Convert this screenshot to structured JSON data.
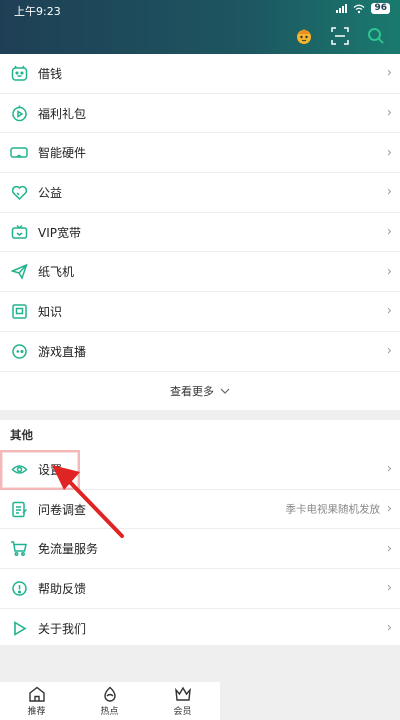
{
  "status_bar": {
    "time": "上午9:23",
    "battery": "96"
  },
  "colors": {
    "accent": "#21b38e",
    "header_start": "#1f3f55",
    "header_end": "#1a7a6f"
  },
  "menu_items": [
    {
      "label": "借钱",
      "icon": "piggy-icon"
    },
    {
      "label": "福利礼包",
      "icon": "play-circle-icon"
    },
    {
      "label": "智能硬件",
      "icon": "vr-glasses-icon"
    },
    {
      "label": "公益",
      "icon": "heart-icon"
    },
    {
      "label": "VIP宽带",
      "icon": "tv-icon"
    },
    {
      "label": "纸飞机",
      "icon": "paper-plane-icon"
    },
    {
      "label": "知识",
      "icon": "book-icon"
    },
    {
      "label": "游戏直播",
      "icon": "gamepad-icon"
    }
  ],
  "see_more": "查看更多",
  "other_section": {
    "title": "其他",
    "items": [
      {
        "label": "设置",
        "icon": "eye-settings-icon",
        "extra": ""
      },
      {
        "label": "问卷调查",
        "icon": "survey-icon",
        "extra": "季卡电视果随机发放"
      },
      {
        "label": "免流量服务",
        "icon": "cart-icon",
        "extra": ""
      },
      {
        "label": "帮助反馈",
        "icon": "help-icon",
        "extra": ""
      },
      {
        "label": "关于我们",
        "icon": "play-icon",
        "extra": ""
      }
    ]
  },
  "tabbar": {
    "items": [
      {
        "label": "推荐",
        "icon": "home-icon"
      },
      {
        "label": "热点",
        "icon": "hot-icon"
      },
      {
        "label": "会员",
        "icon": "crown-icon"
      }
    ]
  }
}
